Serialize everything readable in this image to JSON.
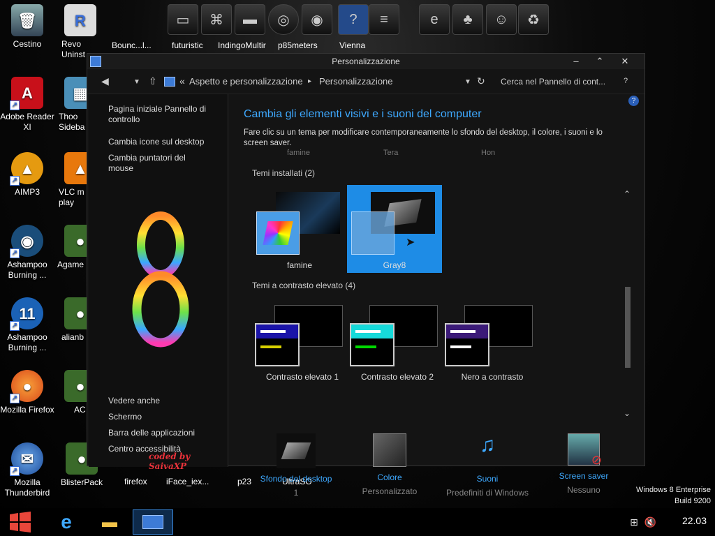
{
  "desktop": {
    "left_icons": [
      {
        "label": "Cestino",
        "glyph": "🗑"
      },
      {
        "label": "Adobe Reader XI",
        "glyph": "A"
      },
      {
        "label": "AIMP3",
        "glyph": "▲"
      },
      {
        "label": "Ashampoo Burning ...",
        "glyph": "◉"
      },
      {
        "label": "Ashampoo Burning ...",
        "glyph": "11"
      },
      {
        "label": "Mozilla Firefox",
        "glyph": "●"
      },
      {
        "label": "Mozilla Thunderbird",
        "glyph": "✉"
      }
    ],
    "second_col": [
      {
        "label": "Revo Uninst"
      },
      {
        "label": "Thoo Sideba"
      },
      {
        "label": "VLC m play"
      },
      {
        "label": "Agame"
      },
      {
        "label": "alianb"
      },
      {
        "label": "AC"
      },
      {
        "label": "BlisterPack"
      }
    ],
    "top_labels": [
      "Bounc...l...",
      "futuristic",
      "IndingoMultir",
      "p85meters",
      "Vienna"
    ],
    "bottom_labels": [
      "firefox",
      "iFace_iex...",
      "p23",
      "UltraSO"
    ],
    "watermark_line1": "Windows 8 Enterprise",
    "watermark_line2": "Build 9200"
  },
  "window": {
    "title": "Personalizzazione",
    "breadcrumb": {
      "prefix": "«",
      "item1": "Aspetto e personalizzazione",
      "sep": "▸",
      "item2": "Personalizzazione"
    },
    "search_placeholder": "Cerca nel Pannello di cont...",
    "help": "?",
    "sidebar": {
      "links_top": [
        "Pagina iniziale Pannello di controllo",
        "Cambia icone sul desktop",
        "Cambia puntatori del mouse"
      ],
      "see_also": "Vedere anche",
      "links_bottom": [
        "Schermo",
        "Barra delle applicazioni",
        "Centro accessibilità"
      ],
      "credit": "coded by SaivaXP"
    },
    "heading": "Cambia gli elementi visivi e i suoni del computer",
    "description": "Fare clic su un tema per modificare contemporaneamente lo sfondo del desktop, il colore, i suoni e lo screen saver.",
    "partial_labels": [
      "famine",
      "Tera",
      "Hon"
    ],
    "installed_section": "Temi installati (2)",
    "installed_themes": [
      {
        "label": "famine",
        "selected": false
      },
      {
        "label": "Gray8",
        "selected": true
      }
    ],
    "high_contrast_section": "Temi a contrasto elevato (4)",
    "high_contrast_themes": [
      {
        "label": "Contrasto elevato 1",
        "bar": "#1b14a8",
        "line1": "#ffffff",
        "line2": "#d7d000"
      },
      {
        "label": "Contrasto elevato 2",
        "bar": "#16dada",
        "line1": "#ffffff",
        "line2": "#00d800"
      },
      {
        "label": "Nero a contrasto",
        "bar": "#3b1a78",
        "line1": "#ffffff",
        "line2": "#ffffff"
      }
    ],
    "bottom_items": [
      {
        "title": "Sfondo del desktop",
        "subtitle": "1"
      },
      {
        "title": "Colore",
        "subtitle": "Personalizzato"
      },
      {
        "title": "Suoni",
        "subtitle": "Predefiniti di Windows"
      },
      {
        "title": "Screen saver",
        "subtitle": "Nessuno"
      }
    ]
  },
  "taskbar": {
    "clock": "22.03"
  },
  "colors": {
    "accent": "#3ea9ff",
    "selection": "#1e8ce6"
  }
}
